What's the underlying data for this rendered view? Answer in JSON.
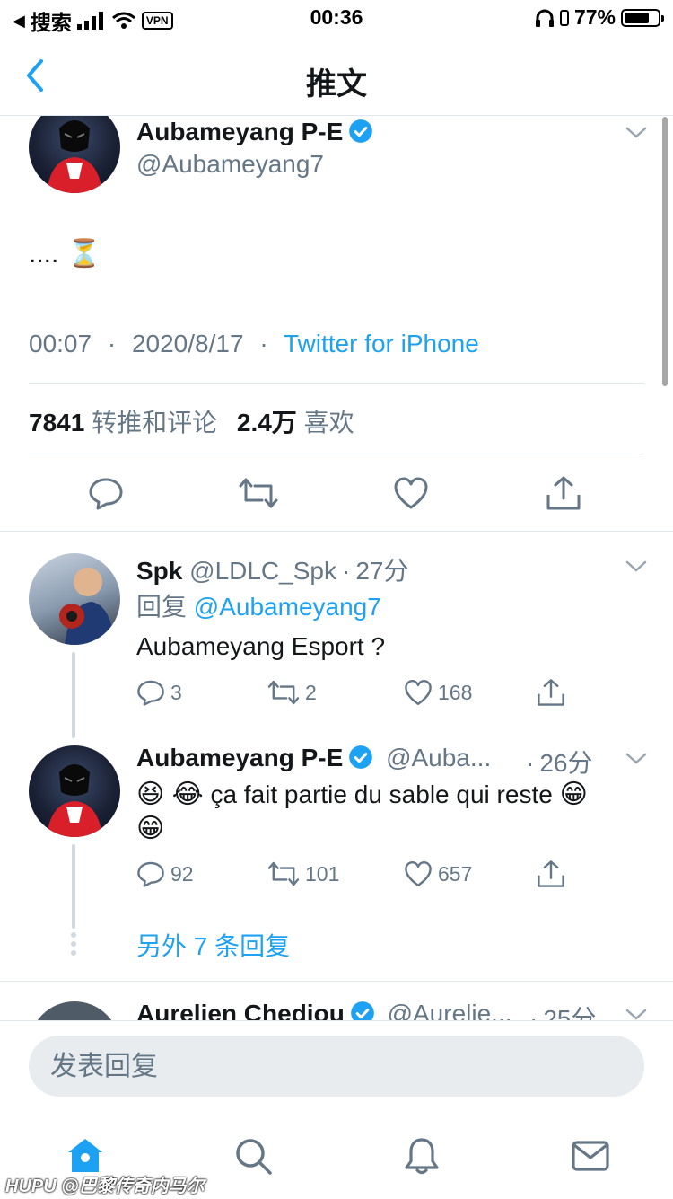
{
  "status_bar": {
    "back_app": "搜索",
    "vpn": "VPN",
    "time": "00:36",
    "battery_percent": "77%",
    "battery_level": 0.77
  },
  "nav": {
    "title": "推文"
  },
  "main_tweet": {
    "author_name": "Aubameyang P-E",
    "handle": "@Aubameyang7",
    "text": "....",
    "emoji": "⏳",
    "time": "00:07",
    "date": "2020/8/17",
    "source": "Twitter for iPhone",
    "sep": "·",
    "retweets_count": "7841",
    "retweets_label": "转推和评论",
    "likes_count": "2.4万",
    "likes_label": "喜欢",
    "icons": [
      "reply-icon",
      "retweet-icon",
      "like-icon",
      "share-icon"
    ]
  },
  "replies": [
    {
      "author_name": "Spk",
      "handle": "@LDLC_Spk",
      "sep": "·",
      "time_ago": "27分",
      "reply_prefix": "回复",
      "reply_to": "@Aubameyang7",
      "text": "Aubameyang Esport ?",
      "reply_count": "3",
      "retweet_count": "2",
      "like_count": "168"
    },
    {
      "author_name": "Aubameyang P-E",
      "handle": "@Auba...",
      "sep": "·",
      "time_ago": "26分",
      "text_line1_emoji": "😆 😂",
      "text_line1": "ça fait partie du sable qui reste",
      "text_line1_end_emoji": "😁",
      "text_line2_emoji": "😁",
      "reply_count": "92",
      "retweet_count": "101",
      "like_count": "657"
    }
  ],
  "more_replies": "另外 7 条回复",
  "next_reply": {
    "author_name": "Aurelien Chediou",
    "handle": "@Aurelie...",
    "sep": "·",
    "time_ago": "25分"
  },
  "compose": {
    "placeholder": "发表回复"
  },
  "tabs": [
    "home-icon",
    "search-icon",
    "notifications-icon",
    "messages-icon"
  ],
  "watermark": "HUPU @巴黎传奇内马尔",
  "colors": {
    "accent": "#1da1f2",
    "text": "#14171a",
    "muted": "#657786",
    "divider": "#e1e8ed"
  }
}
